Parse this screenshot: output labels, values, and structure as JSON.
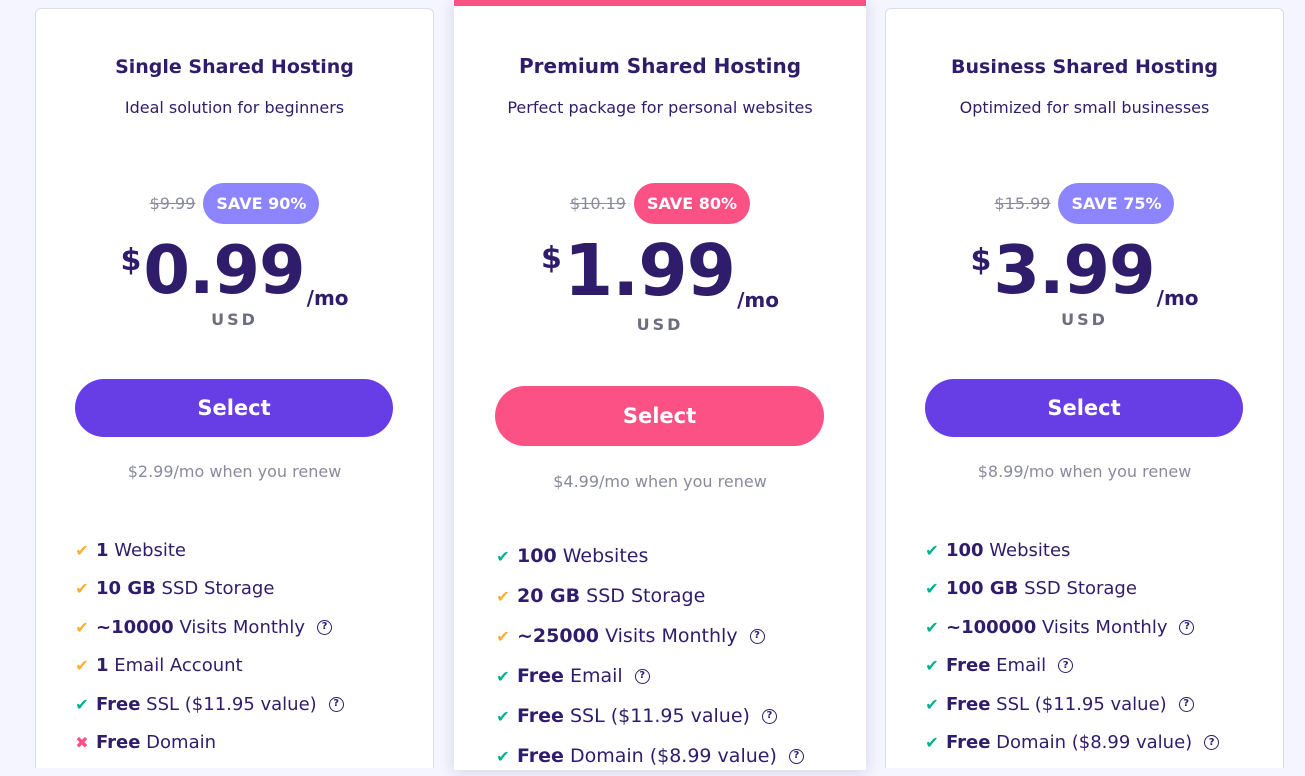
{
  "plans": [
    {
      "title": "Single Shared Hosting",
      "subtitle": "Ideal solution for beginners",
      "old_price": "$9.99",
      "save_badge": "SAVE 90%",
      "currency_symbol": "$",
      "price": "0.99",
      "period": "/mo",
      "currency": "USD",
      "select_label": "Select",
      "renew_text": "$2.99/mo when you renew",
      "badge_color": "#8c85ff",
      "button_color": "#673de6",
      "features": [
        {
          "bold": "1",
          "text": " Website",
          "mark": "check-orange",
          "help": false
        },
        {
          "bold": "10 GB",
          "text": " SSD Storage",
          "mark": "check-orange",
          "help": false
        },
        {
          "bold": "~10000",
          "text": " Visits Monthly",
          "mark": "check-orange",
          "help": true
        },
        {
          "bold": "1",
          "text": " Email Account",
          "mark": "check-orange",
          "help": false
        },
        {
          "bold": "Free",
          "text": " SSL ($11.95 value)",
          "mark": "check-green",
          "help": true
        },
        {
          "bold": "Free",
          "text": " Domain",
          "mark": "cross-red",
          "help": false
        }
      ]
    },
    {
      "title": "Premium Shared Hosting",
      "subtitle": "Perfect package for personal websites",
      "old_price": "$10.19",
      "save_badge": "SAVE 80%",
      "currency_symbol": "$",
      "price": "1.99",
      "period": "/mo",
      "currency": "USD",
      "select_label": "Select",
      "renew_text": "$4.99/mo when you renew",
      "badge_color": "#fc5185",
      "button_color": "#fc5185",
      "features": [
        {
          "bold": "100",
          "text": " Websites",
          "mark": "check-green",
          "help": false
        },
        {
          "bold": "20 GB",
          "text": " SSD Storage",
          "mark": "check-orange",
          "help": false
        },
        {
          "bold": "~25000",
          "text": " Visits Monthly",
          "mark": "check-orange",
          "help": true
        },
        {
          "bold": "Free",
          "text": " Email",
          "mark": "check-green",
          "help": true
        },
        {
          "bold": "Free",
          "text": " SSL ($11.95 value)",
          "mark": "check-green",
          "help": true
        },
        {
          "bold": "Free",
          "text": " Domain ($8.99 value)",
          "mark": "check-green",
          "help": true
        }
      ]
    },
    {
      "title": "Business Shared Hosting",
      "subtitle": "Optimized for small businesses",
      "old_price": "$15.99",
      "save_badge": "SAVE 75%",
      "currency_symbol": "$",
      "price": "3.99",
      "period": "/mo",
      "currency": "USD",
      "select_label": "Select",
      "renew_text": "$8.99/mo when you renew",
      "badge_color": "#8c85ff",
      "button_color": "#673de6",
      "features": [
        {
          "bold": "100",
          "text": " Websites",
          "mark": "check-green",
          "help": false
        },
        {
          "bold": "100 GB",
          "text": " SSD Storage",
          "mark": "check-green",
          "help": false
        },
        {
          "bold": "~100000",
          "text": " Visits Monthly",
          "mark": "check-green",
          "help": true
        },
        {
          "bold": "Free",
          "text": " Email",
          "mark": "check-green",
          "help": true
        },
        {
          "bold": "Free",
          "text": " SSL ($11.95 value)",
          "mark": "check-green",
          "help": true
        },
        {
          "bold": "Free",
          "text": " Domain ($8.99 value)",
          "mark": "check-green",
          "help": true
        }
      ]
    }
  ],
  "icons": {
    "check": "checkmark-icon",
    "cross": "cross-icon",
    "help": "question-circle-icon"
  },
  "accent_color": "#fc5185"
}
